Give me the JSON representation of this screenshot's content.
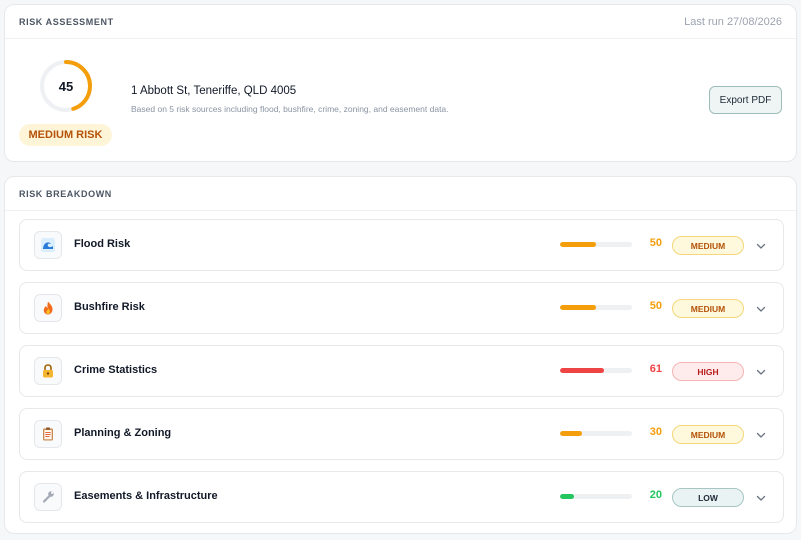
{
  "assessment": {
    "title": "RISK ASSESSMENT",
    "last_run": "Last run 27/08/2026",
    "overall_score": 45,
    "overall_score_text": "45",
    "overall_score_max": 100,
    "overall_level": "MEDIUM RISK",
    "address": "1 Abbott St, Teneriffe, QLD 4005",
    "description": "Based on 5 risk sources including flood, bushfire, crime, zoning, and easement data.",
    "export_label": "Export PDF"
  },
  "breakdown": {
    "title": "RISK BREAKDOWN",
    "items": [
      {
        "name": "Flood Risk",
        "icon": "wave-icon",
        "score": 50,
        "score_text": "50",
        "level": "MEDIUM",
        "color": "#f59e0b"
      },
      {
        "name": "Bushfire Risk",
        "icon": "fire-icon",
        "score": 50,
        "score_text": "50",
        "level": "MEDIUM",
        "color": "#f59e0b"
      },
      {
        "name": "Crime Statistics",
        "icon": "lock-icon",
        "score": 61,
        "score_text": "61",
        "level": "HIGH",
        "color": "#ef4444"
      },
      {
        "name": "Planning & Zoning",
        "icon": "clipboard-icon",
        "score": 30,
        "score_text": "30",
        "level": "MEDIUM",
        "color": "#f59e0b"
      },
      {
        "name": "Easements & Infrastructure",
        "icon": "wrench-icon",
        "score": 20,
        "score_text": "20",
        "level": "LOW",
        "color": "#22c55e"
      }
    ]
  },
  "colors": {
    "medium": "#f59e0b",
    "high": "#ef4444",
    "low": "#22c55e",
    "gauge_track": "#eef0f3"
  }
}
